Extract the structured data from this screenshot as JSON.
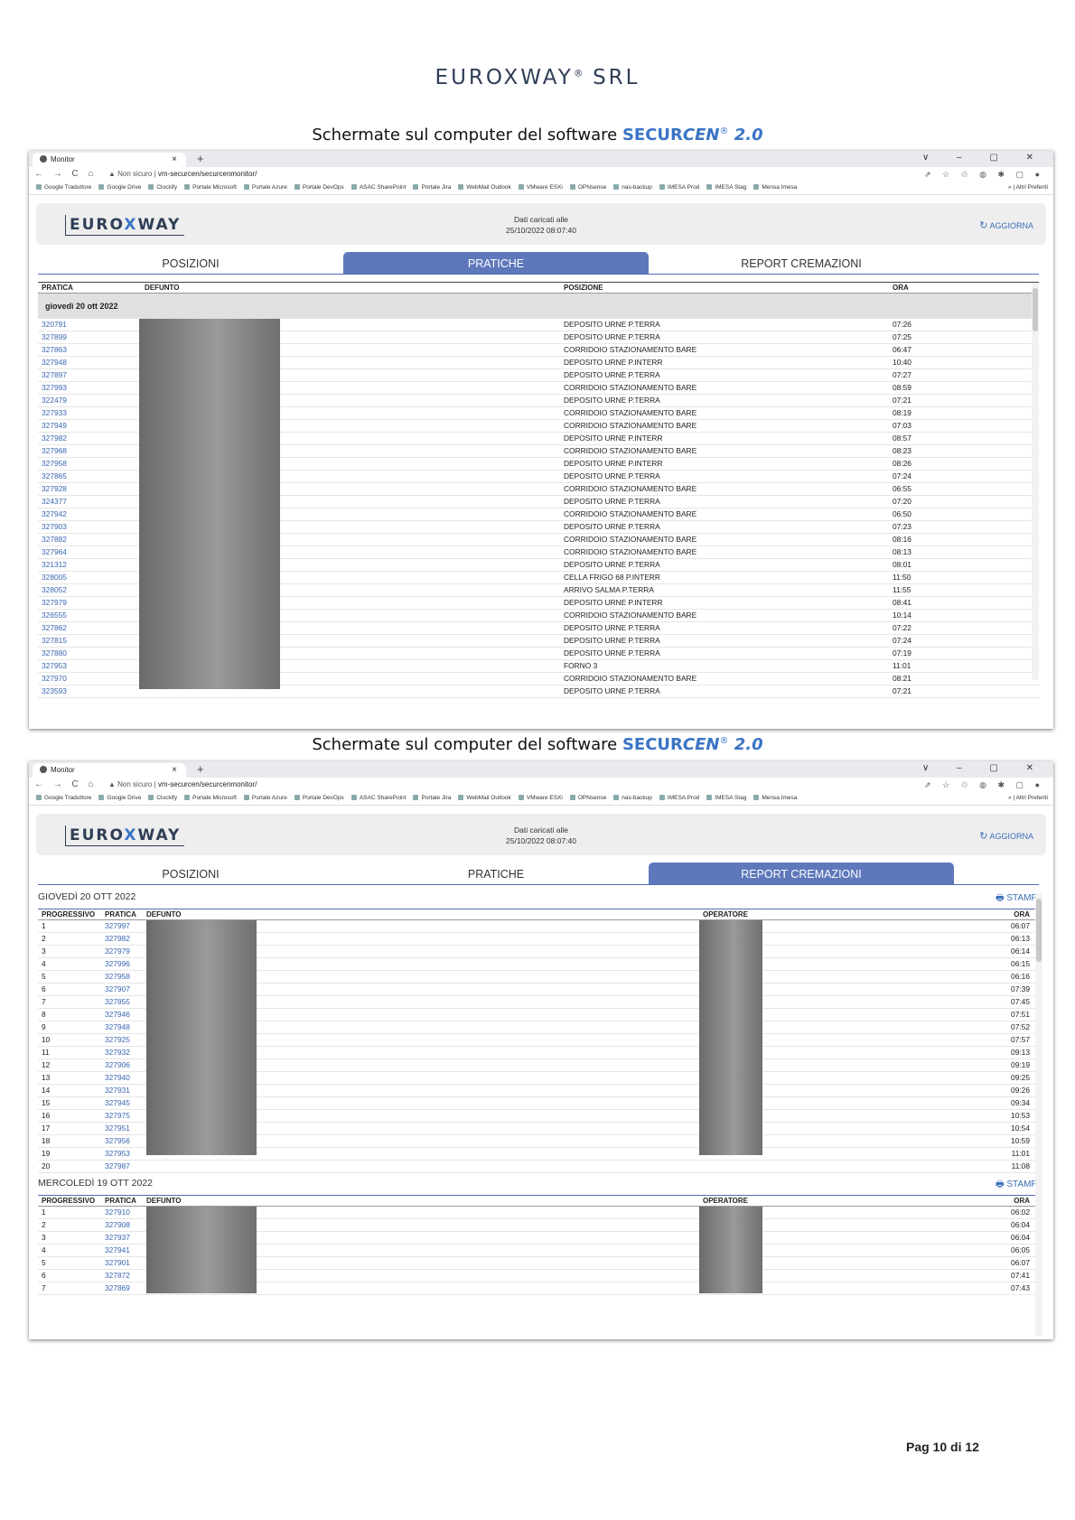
{
  "doc": {
    "company": "EUROXWAY",
    "company_reg": "®",
    "company_suffix": "SRL",
    "caption_text": "Schermate sul computer del software ",
    "product_name_a": "SECUR",
    "product_name_b": "CEN",
    "product_reg": "®",
    "product_version": "2.0",
    "page_label": "Pag 10 di 12"
  },
  "browser": {
    "tab_title": "Monitor",
    "tab_close": "×",
    "new_tab": "+",
    "window_controls": "∨ – ▢ ✕",
    "nav_icons": "← → C ⌂",
    "security": "▲ Non sicuro",
    "url": "vm-securcen/securcenmonitor/",
    "toolbar_icons": "⇗ ☆ ♲ ◍ ✱ ▢ ●",
    "bookmarks": [
      "Google Traduttore",
      "Google Drive",
      "Clockify",
      "Portale Microsoft",
      "Portale Azure",
      "Portale DevOps",
      "ASAC SharePoint",
      "Portale Jira",
      "WebMail Outlook",
      "VMware ESXi",
      "OPNsense",
      "nas-backup",
      "IMESA Prod",
      "IMESA Stag",
      "Mensa Imesa"
    ],
    "other_bookmarks": "» | Altri Preferiti"
  },
  "app": {
    "logo_a": "EURO",
    "logo_x": "X",
    "logo_b": "WAY",
    "loaded_label": "Dati caricati alle",
    "loaded_time": "25/10/2022 08:07:40",
    "refresh_icon": "refresh-icon",
    "refresh_label": "AGGIORNA",
    "tabs": [
      "POSIZIONI",
      "PRATICHE",
      "REPORT CREMAZIONI"
    ],
    "print_label": "STAMPA"
  },
  "pratiche": {
    "headers": {
      "pratica": "PRATICA",
      "defunto": "DEFUNTO",
      "posizione": "POSIZIONE",
      "ora": "ORA"
    },
    "day": "giovedì 20 ott 2022",
    "rows": [
      [
        "320791",
        "DEPOSITO URNE P.TERRA",
        "07:26"
      ],
      [
        "327899",
        "DEPOSITO URNE P.TERRA",
        "07:25"
      ],
      [
        "327863",
        "CORRIDOIO STAZIONAMENTO BARE",
        "06:47"
      ],
      [
        "327948",
        "DEPOSITO URNE P.INTERR",
        "10:40"
      ],
      [
        "327897",
        "DEPOSITO URNE P.TERRA",
        "07:27"
      ],
      [
        "327993",
        "CORRIDOIO STAZIONAMENTO BARE",
        "08:59"
      ],
      [
        "322479",
        "DEPOSITO URNE P.TERRA",
        "07:21"
      ],
      [
        "327933",
        "CORRIDOIO STAZIONAMENTO BARE",
        "08:19"
      ],
      [
        "327949",
        "CORRIDOIO STAZIONAMENTO BARE",
        "07:03"
      ],
      [
        "327982",
        "DEPOSITO URNE P.INTERR",
        "08:57"
      ],
      [
        "327968",
        "CORRIDOIO STAZIONAMENTO BARE",
        "08:23"
      ],
      [
        "327958",
        "DEPOSITO URNE P.INTERR",
        "08:26"
      ],
      [
        "327865",
        "DEPOSITO URNE P.TERRA",
        "07:24"
      ],
      [
        "327928",
        "CORRIDOIO STAZIONAMENTO BARE",
        "06:55"
      ],
      [
        "324377",
        "DEPOSITO URNE P.TERRA",
        "07:20"
      ],
      [
        "327942",
        "CORRIDOIO STAZIONAMENTO BARE",
        "06:50"
      ],
      [
        "327903",
        "DEPOSITO URNE P.TERRA",
        "07:23"
      ],
      [
        "327882",
        "CORRIDOIO STAZIONAMENTO BARE",
        "08:16"
      ],
      [
        "327964",
        "CORRIDOIO STAZIONAMENTO BARE",
        "08:13"
      ],
      [
        "321312",
        "DEPOSITO URNE P.TERRA",
        "08:01"
      ],
      [
        "328005",
        "CELLA FRIGO 68 P.INTERR",
        "11:50"
      ],
      [
        "328052",
        "ARRIVO SALMA P.TERRA",
        "11:55"
      ],
      [
        "327979",
        "DEPOSITO URNE P.INTERR",
        "08:41"
      ],
      [
        "326555",
        "CORRIDOIO STAZIONAMENTO BARE",
        "10:14"
      ],
      [
        "327862",
        "DEPOSITO URNE P.TERRA",
        "07:22"
      ],
      [
        "327815",
        "DEPOSITO URNE P.TERRA",
        "07:24"
      ],
      [
        "327880",
        "DEPOSITO URNE P.TERRA",
        "07:19"
      ],
      [
        "327953",
        "FORNO 3",
        "11:01"
      ],
      [
        "327970",
        "CORRIDOIO STAZIONAMENTO BARE",
        "08:21"
      ],
      [
        "323593",
        "DEPOSITO URNE P.TERRA",
        "07:21"
      ]
    ]
  },
  "report": {
    "headers": {
      "progressivo": "PROGRESSIVO",
      "pratica": "PRATICA",
      "defunto": "DEFUNTO",
      "operatore": "OPERATORE",
      "ora": "ORA"
    },
    "sections": [
      {
        "title": "GIOVEDÌ 20 OTT 2022",
        "rows": [
          [
            "1",
            "327997",
            "06:07"
          ],
          [
            "2",
            "327982",
            "06:13"
          ],
          [
            "3",
            "327979",
            "06:14"
          ],
          [
            "4",
            "327996",
            "06:15"
          ],
          [
            "5",
            "327958",
            "06:16"
          ],
          [
            "6",
            "327907",
            "07:39"
          ],
          [
            "7",
            "327855",
            "07:45"
          ],
          [
            "8",
            "327946",
            "07:51"
          ],
          [
            "9",
            "327948",
            "07:52"
          ],
          [
            "10",
            "327925",
            "07:57"
          ],
          [
            "11",
            "327932",
            "09:13"
          ],
          [
            "12",
            "327906",
            "09:19"
          ],
          [
            "13",
            "327940",
            "09:25"
          ],
          [
            "14",
            "327931",
            "09:26"
          ],
          [
            "15",
            "327945",
            "09:34"
          ],
          [
            "16",
            "327975",
            "10:53"
          ],
          [
            "17",
            "327951",
            "10:54"
          ],
          [
            "18",
            "327956",
            "10:59"
          ],
          [
            "19",
            "327953",
            "11:01"
          ],
          [
            "20",
            "327987",
            "11:08"
          ]
        ]
      },
      {
        "title": "MERCOLEDÌ 19 OTT 2022",
        "rows": [
          [
            "1",
            "327910",
            "06:02"
          ],
          [
            "2",
            "327908",
            "06:04"
          ],
          [
            "3",
            "327937",
            "06:04"
          ],
          [
            "4",
            "327941",
            "06:05"
          ],
          [
            "5",
            "327901",
            "06:07"
          ],
          [
            "6",
            "327872",
            "07:41"
          ],
          [
            "7",
            "327869",
            "07:43"
          ]
        ]
      }
    ]
  }
}
